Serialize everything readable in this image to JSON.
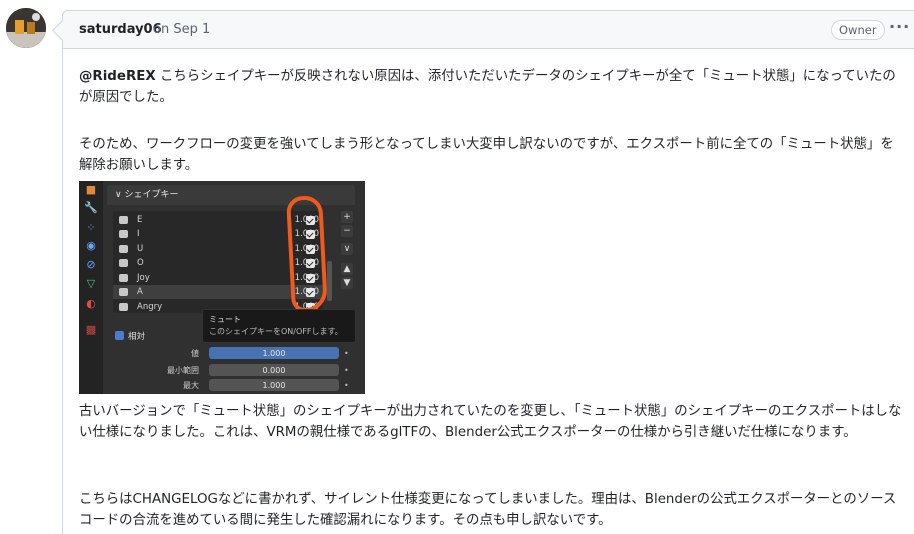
{
  "comment": {
    "author": "saturday06",
    "date": "on Sep 1",
    "badge": "Owner",
    "menu_glyph": "···",
    "paragraphs": [
      {
        "mention": "@RideREX",
        "text": " こちらシェイプキーが反映されない原因は、添付いただいたデータのシェイプキーが全て「ミュート状態」になっていたのが原因でした。"
      },
      {
        "text": "そのため、ワークフローの変更を強いてしまう形となってしまい大変申し訳ないのですが、エクスポート前に全ての「ミュート状態」を解除お願いします。"
      },
      {
        "text": "古いバージョンで「ミュート状態」のシェイプキーが出力されていたのを変更し、「ミュート状態」のシェイプキーのエクスポートはしない仕様になりました。これは、VRMの親仕様であるglTFの、Blender公式エクスポーターの仕様から引き継いだ仕様になります。"
      },
      {
        "text": "こちらはCHANGELOGなどに書かれず、サイレント仕様変更になってしまいました。理由は、Blenderの公式エクスポーターとのソースコードの合流を進めている間に発生した確認漏れになります。その点も申し訳ないです。"
      }
    ]
  },
  "screenshot": {
    "panel_title": "シェイプキー",
    "shape_keys": [
      {
        "name": "E",
        "value": "1.000"
      },
      {
        "name": "I",
        "value": "1.000"
      },
      {
        "name": "U",
        "value": "1.000"
      },
      {
        "name": "O",
        "value": "1.000"
      },
      {
        "name": "Joy",
        "value": "1.000"
      },
      {
        "name": "A",
        "value": "1.000"
      },
      {
        "name": "Angry",
        "value": "1.000"
      }
    ],
    "tooltip_title": "ミュート",
    "tooltip_desc": "このシェイプキーをON/OFFします。",
    "relative_label": "相対",
    "props": [
      {
        "label": "値",
        "value": "1.000"
      },
      {
        "label": "最小範囲",
        "value": "0.000"
      },
      {
        "label": "最大",
        "value": "1.000"
      }
    ]
  }
}
